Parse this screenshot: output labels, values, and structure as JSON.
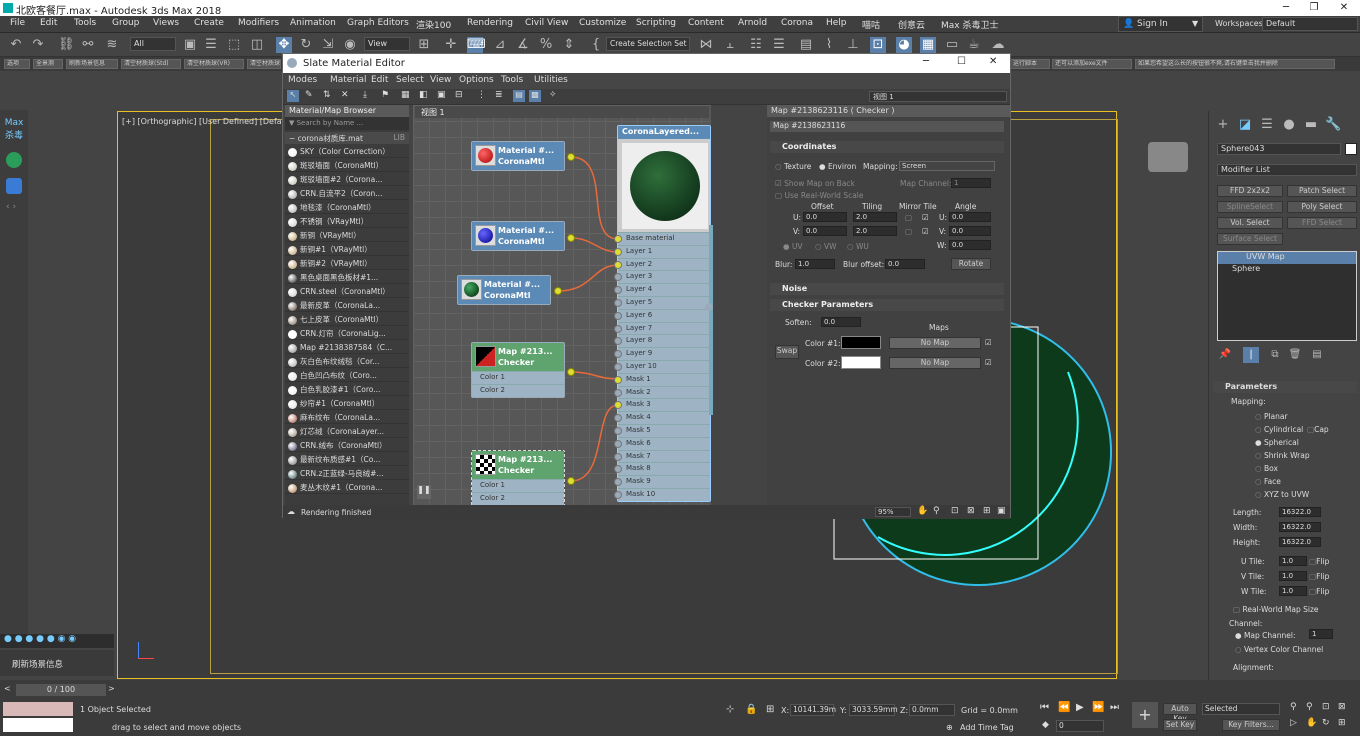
{
  "window": {
    "title": "北欧客餐厅.max - Autodesk 3ds Max 2018",
    "minimize": "─",
    "restore": "❐",
    "close": "✕"
  },
  "menu": [
    "File",
    "Edit",
    "Tools",
    "Group",
    "Views",
    "Create",
    "Modifiers",
    "Animation",
    "Graph Editors",
    "渲染100",
    "Rendering",
    "Civil View",
    "Customize",
    "Scripting",
    "Content",
    "Arnold",
    "Corona",
    "Help",
    "喵咕",
    "创意云",
    "Max 杀毒卫士"
  ],
  "account": {
    "sign_in": "Sign In",
    "workspaces_label": "Workspaces:",
    "workspace": "Default"
  },
  "toolbar": {
    "filter": "All",
    "view": "View",
    "selection_set": "Create Selection Set"
  },
  "quickbar": [
    "选项",
    "全景测",
    "刷新场景信息",
    "清空材质球(Std)",
    "清空材质球(VR)",
    "清空材质球(Corona)",
    "还可以添加exe文件",
    "如果您希望这么长的按钮很不爽,请右键单击我并删除"
  ],
  "quickbar_left": [
    "选项",
    "全景测",
    "刷新场景信息",
    "清空材质球(Std)",
    "清空材质球(VR)",
    "清空材质球"
  ],
  "quickbar_right": [
    "运行脚本",
    "还可以添加exe文件",
    "如果您希望这么长的按钮很不爽,请右键单击我并删除"
  ],
  "left_strip": {
    "max": "Max",
    "label": "杀毒"
  },
  "viewport": {
    "label": "[+] [Orthographic] [User Defined] [Default Shading]"
  },
  "sme": {
    "title": "Slate Material Editor",
    "menu": [
      "Modes",
      "Material",
      "Edit",
      "Select",
      "View",
      "Options",
      "Tools",
      "Utilities"
    ],
    "view_select": "视图 1",
    "browser_title": "Material/Map Browser",
    "search": "Search by Name ...",
    "library": "corona材质库.mat",
    "lib_tag": "LIB",
    "items": [
      {
        "name": "SKY（Color Correction）",
        "c": "#eee"
      },
      {
        "name": "斑驳墙面（CoronaMtl）",
        "c": "#bba"
      },
      {
        "name": "斑驳墙面#2（Corona...",
        "c": "#bba"
      },
      {
        "name": "CRN.自流平2（Coron...",
        "c": "#999"
      },
      {
        "name": "地毯漆（CoronaMtl）",
        "c": "#aaa"
      },
      {
        "name": "不锈钢（VRayMtl）",
        "c": "#ccc"
      },
      {
        "name": "新铜（VRayMtl）",
        "c": "#b96"
      },
      {
        "name": "新铜#1（VRayMtl）",
        "c": "#b96"
      },
      {
        "name": "新铜#2（VRayMtl）",
        "c": "#b96"
      },
      {
        "name": "黑色桌面黑色板材#1...",
        "c": "#222"
      },
      {
        "name": "CRN.steel（CoronaMtl）",
        "c": "#ccc"
      },
      {
        "name": "最新皮革（CoronaLa...",
        "c": "#543"
      },
      {
        "name": "七上皮革（CoronaMtl）",
        "c": "#765"
      },
      {
        "name": "CRN.灯帘（CoronaLig...",
        "c": "#fff"
      },
      {
        "name": "Map #2138387584（C...",
        "c": "#888"
      },
      {
        "name": "灰白色布纹绒毯（Cor...",
        "c": "#aaa"
      },
      {
        "name": "白色凹凸布纹（Coro...",
        "c": "#ddd"
      },
      {
        "name": "白色乳胶漆#1（Coro...",
        "c": "#eee"
      },
      {
        "name": "纱帘#1（CoronaMtl）",
        "c": "#ddd"
      },
      {
        "name": "麻布纹布（CoronaLa...",
        "c": "#a54"
      },
      {
        "name": "灯芯绒（CoronaLayer...",
        "c": "#987"
      },
      {
        "name": "CRN.绒布（CoronaMtl）",
        "c": "#446"
      },
      {
        "name": "最新纹布质感#1（Co...",
        "c": "#777"
      },
      {
        "name": "CRN.z正蓝绿-马良绒#...",
        "c": "#355"
      },
      {
        "name": "麦丛木纹#1（Corona...",
        "c": "#a74"
      }
    ],
    "view_tab": "视图 1",
    "nodes": [
      {
        "title": "Material #...",
        "sub": "CoronaMtl",
        "swatch": "#c22"
      },
      {
        "title": "Material #...",
        "sub": "CoronaMtl",
        "swatch": "#22c"
      },
      {
        "title": "Material #...",
        "sub": "CoronaMtl",
        "swatch": "#163"
      },
      {
        "title": "Map #213...",
        "sub": "Checker",
        "slots": [
          "Color 1",
          "Color 2"
        ]
      },
      {
        "title": "Map #213...",
        "sub": "Checker",
        "slots": [
          "Color 1",
          "Color 2"
        ]
      }
    ],
    "layered": {
      "title": "CoronaLayered...",
      "slots": [
        "Base material",
        "Layer 1",
        "Layer 2",
        "Layer 3",
        "Layer 4",
        "Layer 5",
        "Layer 6",
        "Layer 7",
        "Layer 8",
        "Layer 9",
        "Layer 10",
        "Mask 1",
        "Mask 2",
        "Mask 3",
        "Mask 4",
        "Mask 5",
        "Mask 6",
        "Mask 7",
        "Mask 8",
        "Mask 9",
        "Mask 10"
      ]
    },
    "param_title": "Map #2138623116 ( Checker )",
    "param_name": "Map #2138623116",
    "coords": {
      "header": "Coordinates",
      "texture": "Texture",
      "environ": "Environ",
      "mapping_label": "Mapping:",
      "mapping": "Screen",
      "show_map": "Show Map on Back",
      "map_channel": "Map Channel:",
      "map_channel_val": "1",
      "real_world": "Use Real-World Scale",
      "offset": "Offset",
      "tiling": "Tiling",
      "mirror_tile": "Mirror Tile",
      "angle": "Angle",
      "u": "U:",
      "v": "V:",
      "w": "W:",
      "u_off": "0.0",
      "v_off": "0.0",
      "u_til": "2.0",
      "v_til": "2.0",
      "ang_u": "0.0",
      "ang_v": "0.0",
      "ang_w": "0.0",
      "uv": "UV",
      "vw": "VW",
      "wu": "WU",
      "blur_label": "Blur:",
      "blur": "1.0",
      "blur_off_label": "Blur offset:",
      "blur_off": "0.0",
      "rotate": "Rotate"
    },
    "noise": "Noise",
    "checker": {
      "header": "Checker Parameters",
      "soften_label": "Soften:",
      "soften": "0.0",
      "maps": "Maps",
      "swap": "Swap",
      "color1": "Color #1:",
      "color2": "Color #2:",
      "no_map": "No Map",
      "c1": "#000000",
      "c2": "#ffffff"
    },
    "status": "Rendering finished",
    "zoom": "95%"
  },
  "right_panel": {
    "object": "Sphere043",
    "modifier_list": "Modifier List",
    "buttons": [
      "FFD 2x2x2",
      "Patch Select",
      "SplineSelect",
      "Poly Select",
      "Vol. Select",
      "FFD Select",
      "Surface Select"
    ],
    "stack": [
      "UVW Map",
      "Sphere"
    ],
    "params_header": "Parameters",
    "mapping_label": "Mapping:",
    "mapping_opts": [
      "Planar",
      "Cylindrical",
      "Spherical",
      "Shrink Wrap",
      "Box",
      "Face",
      "XYZ to UVW"
    ],
    "cap": "Cap",
    "length_label": "Length:",
    "length": "16322.0",
    "width_label": "Width:",
    "width": "16322.0",
    "height_label": "Height:",
    "height": "16322.0",
    "utile_label": "U Tile:",
    "utile": "1.0",
    "vtile_label": "V Tile:",
    "vtile": "1.0",
    "wtile_label": "W Tile:",
    "wtile": "1.0",
    "flip": "Flip",
    "rw_map": "Real-World Map Size",
    "channel": "Channel:",
    "map_channel": "Map Channel:",
    "map_channel_val": "1",
    "vertex_channel": "Vertex Color Channel",
    "alignment": "Alignment:"
  },
  "status": {
    "script_label": "刷新场景信息",
    "frames": "0 / 100",
    "selected": "1 Object Selected",
    "hint": "drag to select and move objects",
    "x_label": "X:",
    "x": "10141.39m",
    "y_label": "Y:",
    "y": "3033.59mm",
    "z_label": "Z:",
    "z": "0.0mm",
    "grid": "Grid = 0.0mm",
    "add_time_tag": "Add Time Tag",
    "auto_key": "Auto Key",
    "set_key": "Set Key",
    "selected_dd": "Selected",
    "key_filters": "Key Filters...",
    "frame": "0"
  }
}
